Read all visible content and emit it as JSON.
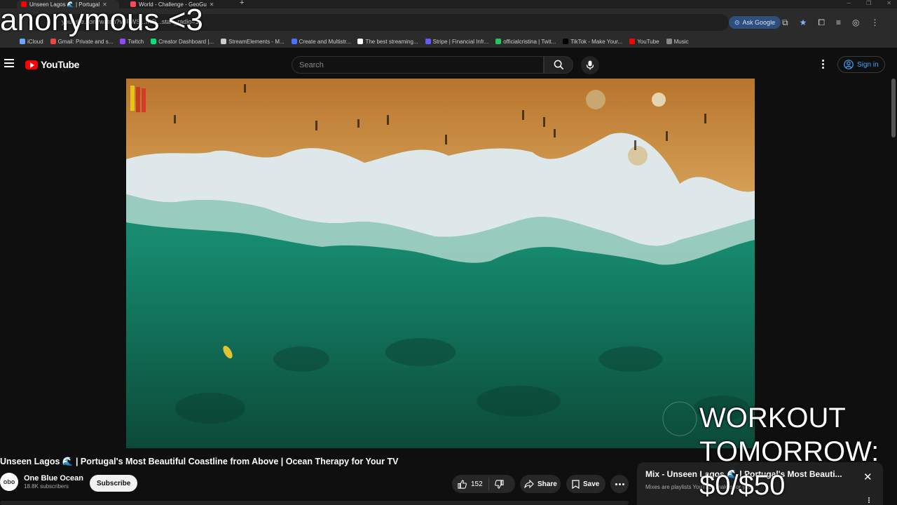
{
  "overlay": {
    "top_text": "anonymous <3",
    "bottom_right_text": "WORKOUT\nTOMORROW:\n$0/$50"
  },
  "browser": {
    "tabs": [
      {
        "title": "Unseen Lagos 🌊 | Portugal",
        "active": true,
        "favicon_color": "#ff0000"
      },
      {
        "title": "World - Challenge - GeoGu",
        "active": false,
        "favicon_color": "#ff4a55"
      }
    ],
    "url": "youtube.com/watch?v=FWS...fRD...start_radio=1",
    "ask_google": "Ask Google",
    "bookmarks": [
      {
        "label": "iCloud",
        "color": "#6aa9ff"
      },
      {
        "label": "Gmail: Private and s...",
        "color": "#e44"
      },
      {
        "label": "Twitch",
        "color": "#9146ff"
      },
      {
        "label": "Creator Dashboard |...",
        "color": "#00e676"
      },
      {
        "label": "StreamElements - M...",
        "color": "#cccccc"
      },
      {
        "label": "Create and Multistr...",
        "color": "#4c6fff"
      },
      {
        "label": "The best streaming...",
        "color": "#ffffff"
      },
      {
        "label": "Stripe | Financial Infr...",
        "color": "#635bff"
      },
      {
        "label": "officialcristina | Twit...",
        "color": "#22c55e"
      },
      {
        "label": "TikTok - Make Your...",
        "color": "#000000"
      },
      {
        "label": "YouTube",
        "color": "#ff0000"
      },
      {
        "label": "Music",
        "color": "#888888"
      }
    ]
  },
  "youtube": {
    "logo_text": "YouTube",
    "search_placeholder": "Search",
    "sign_in": "Sign in"
  },
  "video": {
    "title": "Unseen Lagos 🌊 | Portugal's Most Beautiful Coastline from Above | Ocean Therapy for Your TV",
    "channel_name": "One Blue Ocean",
    "channel_avatar": "obo",
    "subscribers": "18.8K subscribers",
    "subscribe_label": "Subscribe",
    "likes": "152",
    "share_label": "Share",
    "save_label": "Save"
  },
  "mix": {
    "title": "Mix - Unseen Lagos 🌊 | Portugal's Most Beauti...",
    "subtitle": "Mixes are playlists YouTube makes for you"
  }
}
